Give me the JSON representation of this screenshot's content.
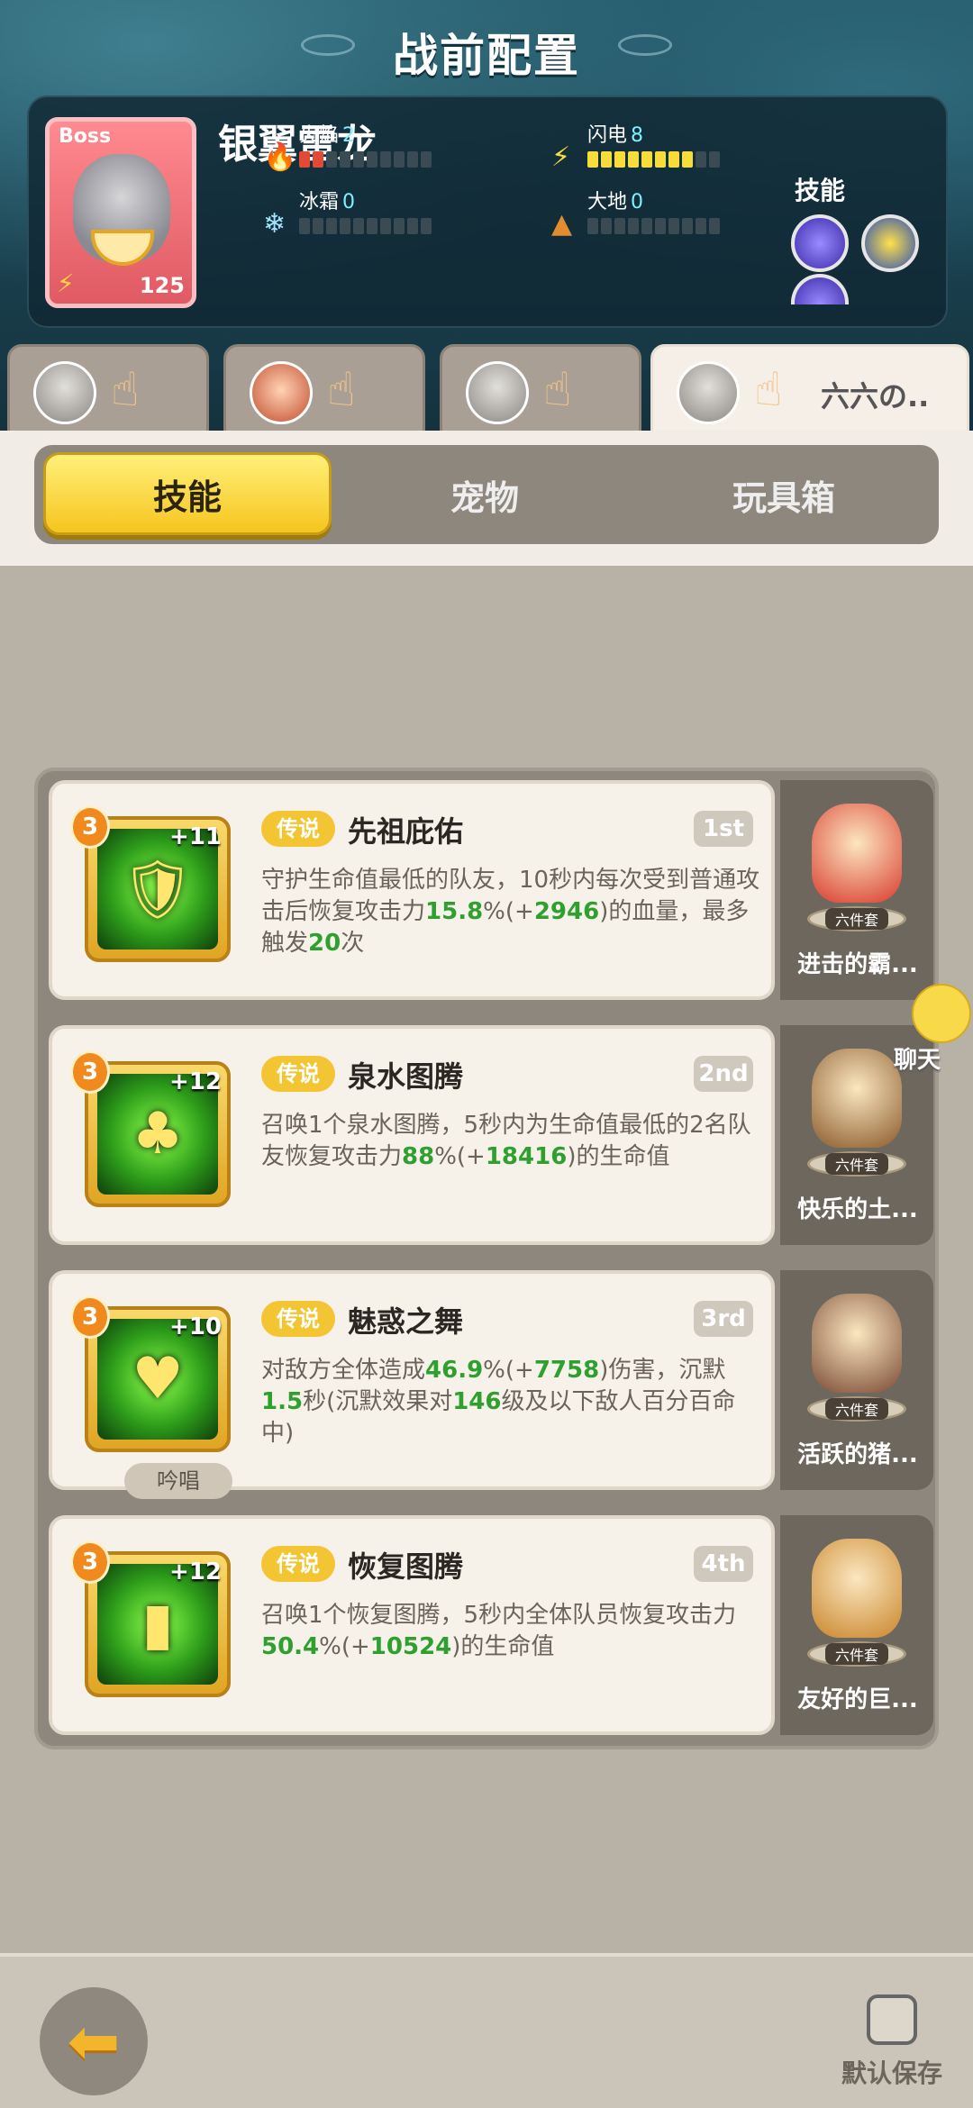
{
  "header": {
    "title": "战前配置"
  },
  "boss": {
    "tag": "Boss",
    "name": "银翼雷龙",
    "level": "125",
    "stats": [
      {
        "label": "火焰",
        "value": "2",
        "fill": 2,
        "color": "#e24a35",
        "icon": "flame-icon"
      },
      {
        "label": "闪电",
        "value": "8",
        "fill": 8,
        "color": "#f6dd3a",
        "icon": "lightning-icon"
      },
      {
        "label": "冰霜",
        "value": "0",
        "fill": 0,
        "color": "#9fe6ff",
        "icon": "snowflake-icon"
      },
      {
        "label": "大地",
        "value": "0",
        "fill": 0,
        "color": "#e08c2f",
        "icon": "earth-icon"
      }
    ],
    "skills_label": "技能"
  },
  "hero_tabs": [
    {
      "name": "",
      "active": false
    },
    {
      "name": "",
      "active": false
    },
    {
      "name": "",
      "active": false
    },
    {
      "name": "六六の..",
      "active": true
    }
  ],
  "segment": {
    "tabs": [
      "技能",
      "宠物",
      "玩具箱"
    ],
    "active": 0
  },
  "skills": [
    {
      "stars": "3",
      "plus": "+11",
      "rarity": "传说",
      "name": "先祖庇佑",
      "rank": "1st",
      "desc": [
        {
          "t": "守护生命值最低的队友，10秒内每次受到普通攻击后恢复攻击力"
        },
        {
          "t": "15.8",
          "g": true
        },
        {
          "t": "%(+"
        },
        {
          "t": "2946",
          "g": true
        },
        {
          "t": ")的血量，最多触发"
        },
        {
          "t": "20",
          "g": true
        },
        {
          "t": "次"
        }
      ],
      "chant": "",
      "pet": {
        "name": "进击的霸...",
        "set": "六件套"
      }
    },
    {
      "stars": "3",
      "plus": "+12",
      "rarity": "传说",
      "name": "泉水图腾",
      "rank": "2nd",
      "desc": [
        {
          "t": "召唤1个泉水图腾，5秒内为生命值最低的2名队友恢复攻击力"
        },
        {
          "t": "88",
          "g": true
        },
        {
          "t": "%(+"
        },
        {
          "t": "18416",
          "g": true
        },
        {
          "t": ")的生命值"
        }
      ],
      "chant": "",
      "pet": {
        "name": "快乐的土...",
        "set": "六件套"
      }
    },
    {
      "stars": "3",
      "plus": "+10",
      "rarity": "传说",
      "name": "魅惑之舞",
      "rank": "3rd",
      "desc": [
        {
          "t": "对敌方全体造成"
        },
        {
          "t": "46.9",
          "g": true
        },
        {
          "t": "%(+"
        },
        {
          "t": "7758",
          "g": true
        },
        {
          "t": ")伤害，沉默"
        },
        {
          "t": "1.5",
          "g": true
        },
        {
          "t": "秒(沉默效果对"
        },
        {
          "t": "146",
          "g": true
        },
        {
          "t": "级及以下敌人百分百命中)"
        }
      ],
      "chant": "吟唱",
      "pet": {
        "name": "活跃的猪...",
        "set": "六件套"
      }
    },
    {
      "stars": "3",
      "plus": "+12",
      "rarity": "传说",
      "name": "恢复图腾",
      "rank": "4th",
      "desc": [
        {
          "t": "召唤1个恢复图腾，5秒内全体队员恢复攻击力"
        },
        {
          "t": "50.4",
          "g": true
        },
        {
          "t": "%(+"
        },
        {
          "t": "10524",
          "g": true
        },
        {
          "t": ")的生命值"
        }
      ],
      "chant": "",
      "pet": {
        "name": "友好的巨...",
        "set": "六件套"
      }
    }
  ],
  "chat": {
    "label": "聊天"
  },
  "footer": {
    "default_save_label": "默认保存",
    "default_save_checked": false
  }
}
